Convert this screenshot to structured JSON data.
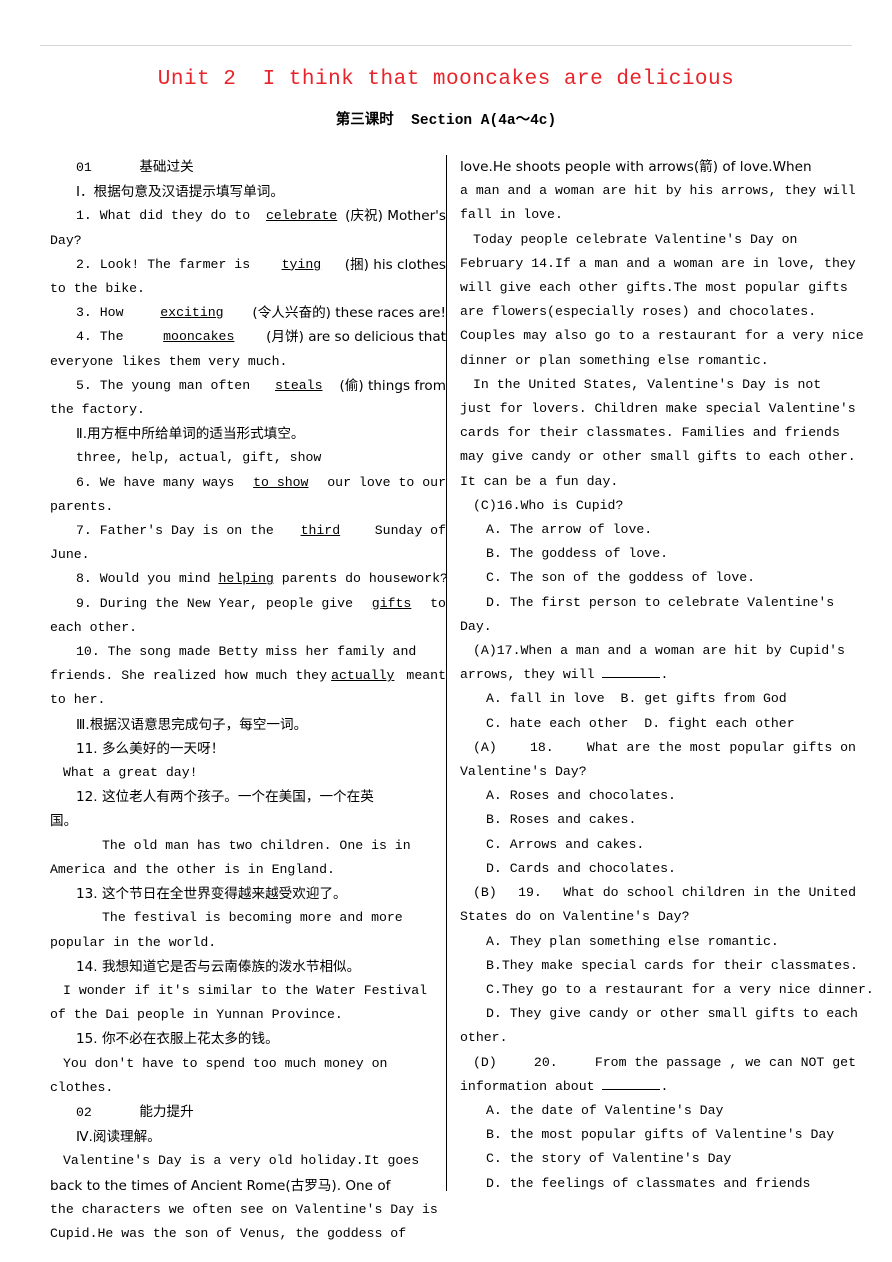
{
  "header": {
    "unit_title": "Unit 2  I think that mooncakes are delicious",
    "unit_title_color": "#e8232a",
    "lesson_line": "第三课时  Section A(4a～4c)"
  },
  "left_column": {
    "section_01_number": "01",
    "section_01_label": "基础过关",
    "part_1_heading": "Ⅰ．根据句意及汉语提示填写单词。",
    "q1_a": "1. What did they do to ",
    "q1_answer": "celebrate",
    "q1_b": "(庆祝) Mother's",
    "q1_cont": "Day?",
    "q2_a": "2. Look! The farmer is ",
    "q2_answer": "tying",
    "q2_b": "(捆) his clothes",
    "q2_cont": "to the bike.",
    "q3_a": "3. How ",
    "q3_answer": "exciting",
    "q3_b": "(令人兴奋的) these races are!",
    "q4_a": "4. The ",
    "q4_answer": "mooncakes",
    "q4_b": "(月饼) are so delicious that",
    "q4_cont": "everyone likes them very much.",
    "q5_a": "5. The young man often ",
    "q5_answer": "steals",
    "q5_b": "(偷) things from",
    "q5_cont": "the factory.",
    "part_2_heading": "Ⅱ.用方框中所给单词的适当形式填空。",
    "word_box": "three, help, actual, gift, show",
    "q6_a": "6. We have many ways ",
    "q6_answer": "to show",
    "q6_b": " our love to our",
    "q6_cont": "parents.",
    "q7_a": "7. Father's Day is on the",
    "q7_answer": "third",
    "q7_b": " Sunday of",
    "q7_cont": "June.",
    "q8_a": "8. Would you mind ",
    "q8_answer": "helping",
    "q8_b": " parents do housework?",
    "q9_a": "9. During the New Year, people give ",
    "q9_answer": "gifts",
    "q9_b": " to",
    "q9_cont": "each other.",
    "q10_a": "10. The song made Betty miss her family and",
    "q10_b1": "friends. She realized how much they",
    "q10_answer": "actually",
    "q10_b2": " meant",
    "q10_cont": "to her.",
    "part_3_heading": "Ⅲ.根据汉语意思完成句子，每空一词。",
    "q11_cn": "11. 多么美好的一天呀！",
    "q11_en": "What a great day!",
    "q12_cn": "12. 这位老人有两个孩子。一个在美国，一个在英",
    "q12_cn_cont": "国。",
    "q12_en_1": "The old man has two children. One is in",
    "q12_en_2": "America and the other is in England.",
    "q13_cn": "13. 这个节日在全世界变得越来越受欢迎了。",
    "q13_en_1": "The festival is becoming more and more",
    "q13_en_2": "popular in the world.",
    "q14_cn": "14. 我想知道它是否与云南傣族的泼水节相似。",
    "q14_en_1": "I wonder if it's similar to the Water Festival",
    "q14_en_2": "of the Dai people in Yunnan Province.",
    "q15_cn": "15. 你不必在衣服上花太多的钱。",
    "q15_en_1": "You don't have to spend too much money on",
    "q15_en_2": "clothes.",
    "section_02_number": "02",
    "section_02_label": "能力提升",
    "part_4_heading": "Ⅳ.阅读理解。",
    "passage_l1": "Valentine's Day is a very old holiday.It goes",
    "passage_l2": "back to the times of Ancient Rome(古罗马). One of",
    "passage_l3": "the characters we often see on Valentine's Day is",
    "passage_l4": "Cupid.He was the son of Venus, the goddess of"
  },
  "right_column": {
    "passage_l5": "love.He shoots people with arrows(箭) of love.When",
    "passage_l6": "a man and a woman are hit by his arrows, they will",
    "passage_l7": "fall in love.",
    "passage_l8": "Today people celebrate Valentine's Day on",
    "passage_l9": "February 14.If a man and a woman are in love, they",
    "passage_l10": "will give each other gifts.The most popular gifts",
    "passage_l11": "are flowers(especially roses) and chocolates.",
    "passage_l12": "Couples may also go to a restaurant for a very nice",
    "passage_l13": "dinner or plan something else romantic.",
    "passage_l14": "In the United States, Valentine's Day is not",
    "passage_l15": "just for lovers. Children make special Valentine's",
    "passage_l16": "cards for their classmates. Families and friends",
    "passage_l17": "may give candy or other small gifts to each other.",
    "passage_l18": "It can be a fun day.",
    "questions": [
      {
        "answer": "(C)",
        "number": "16.",
        "stem": "Who is Cupid?",
        "stem_cont": "",
        "options": [
          "A. The arrow of love.",
          "B. The goddess of love.",
          "C. The son of the goddess of love.",
          "D. The first person to celebrate Valentine's"
        ],
        "option_overflow": "Day."
      },
      {
        "answer": "(A)",
        "number": "17.",
        "stem": "When a man and a woman are hit by Cupid's",
        "stem_cont": "arrows, they will ",
        "stem_cont_tail": ".",
        "options": [
          "A. fall in love  B. get gifts from God",
          "C. hate each other  D. fight each other"
        ],
        "option_overflow": ""
      },
      {
        "answer": "(A)",
        "number": "18.",
        "stem": "What are the most popular gifts on",
        "stem_cont": "Valentine's Day?",
        "options": [
          "A. Roses and chocolates.",
          "B. Roses and cakes.",
          "C. Arrows and cakes.",
          "D. Cards and chocolates."
        ],
        "option_overflow": ""
      },
      {
        "answer": "(B)",
        "number": "19.",
        "stem": "What do school children in the United",
        "stem_cont": "States do on Valentine's Day?",
        "options": [
          "A. They plan something else romantic.",
          "B.They make special cards for their classmates.",
          "C.They go to a restaurant for a very nice dinner.",
          "D. They give candy or other small gifts to each"
        ],
        "option_overflow": "other."
      },
      {
        "answer": "(D)",
        "number": "20.",
        "stem": "From the passage , we can NOT get",
        "stem_cont": "information about ",
        "stem_cont_tail": ".",
        "options": [
          "A. the date of Valentine's Day",
          "B. the most popular gifts of Valentine's Day",
          "C. the story of Valentine's Day",
          "D. the feelings of classmates and friends"
        ],
        "option_overflow": ""
      }
    ]
  }
}
